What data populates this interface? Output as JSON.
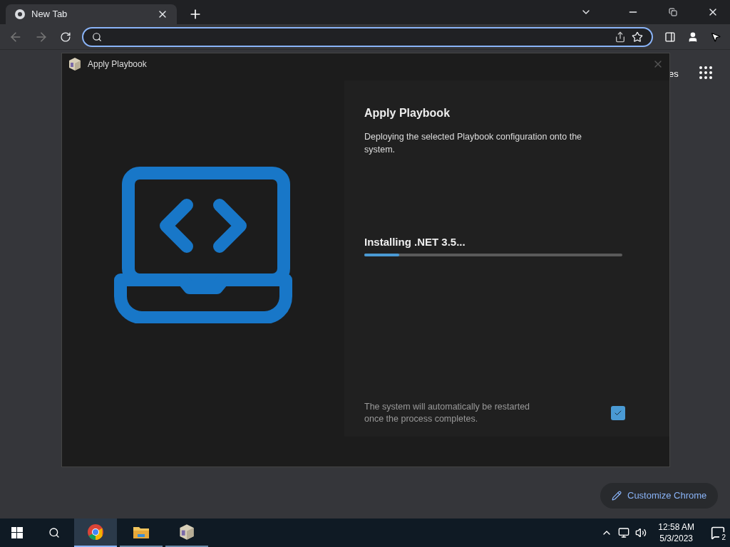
{
  "browser": {
    "tab": {
      "title": "New Tab",
      "selected": true
    },
    "page": {
      "partial_link": "es",
      "customize_button": "Customize Chrome"
    }
  },
  "dialog": {
    "title": "Apply Playbook",
    "heading": "Apply Playbook",
    "description": "Deploying the selected Playbook configuration onto the system.",
    "status": "Installing .NET 3.5...",
    "progress": {
      "level": 0.135
    },
    "restart_note": "The system will automatically be restarted once the process completes.",
    "restart_checkbox": {
      "checked": true
    }
  },
  "taskbar": {
    "apps": [
      {
        "kind": "chrome",
        "selected": true
      },
      {
        "kind": "explorer",
        "selected": false
      },
      {
        "kind": "playbook",
        "selected": false
      }
    ],
    "time": "12:58 AM",
    "date": "5/3/2023",
    "notifications": "2"
  }
}
